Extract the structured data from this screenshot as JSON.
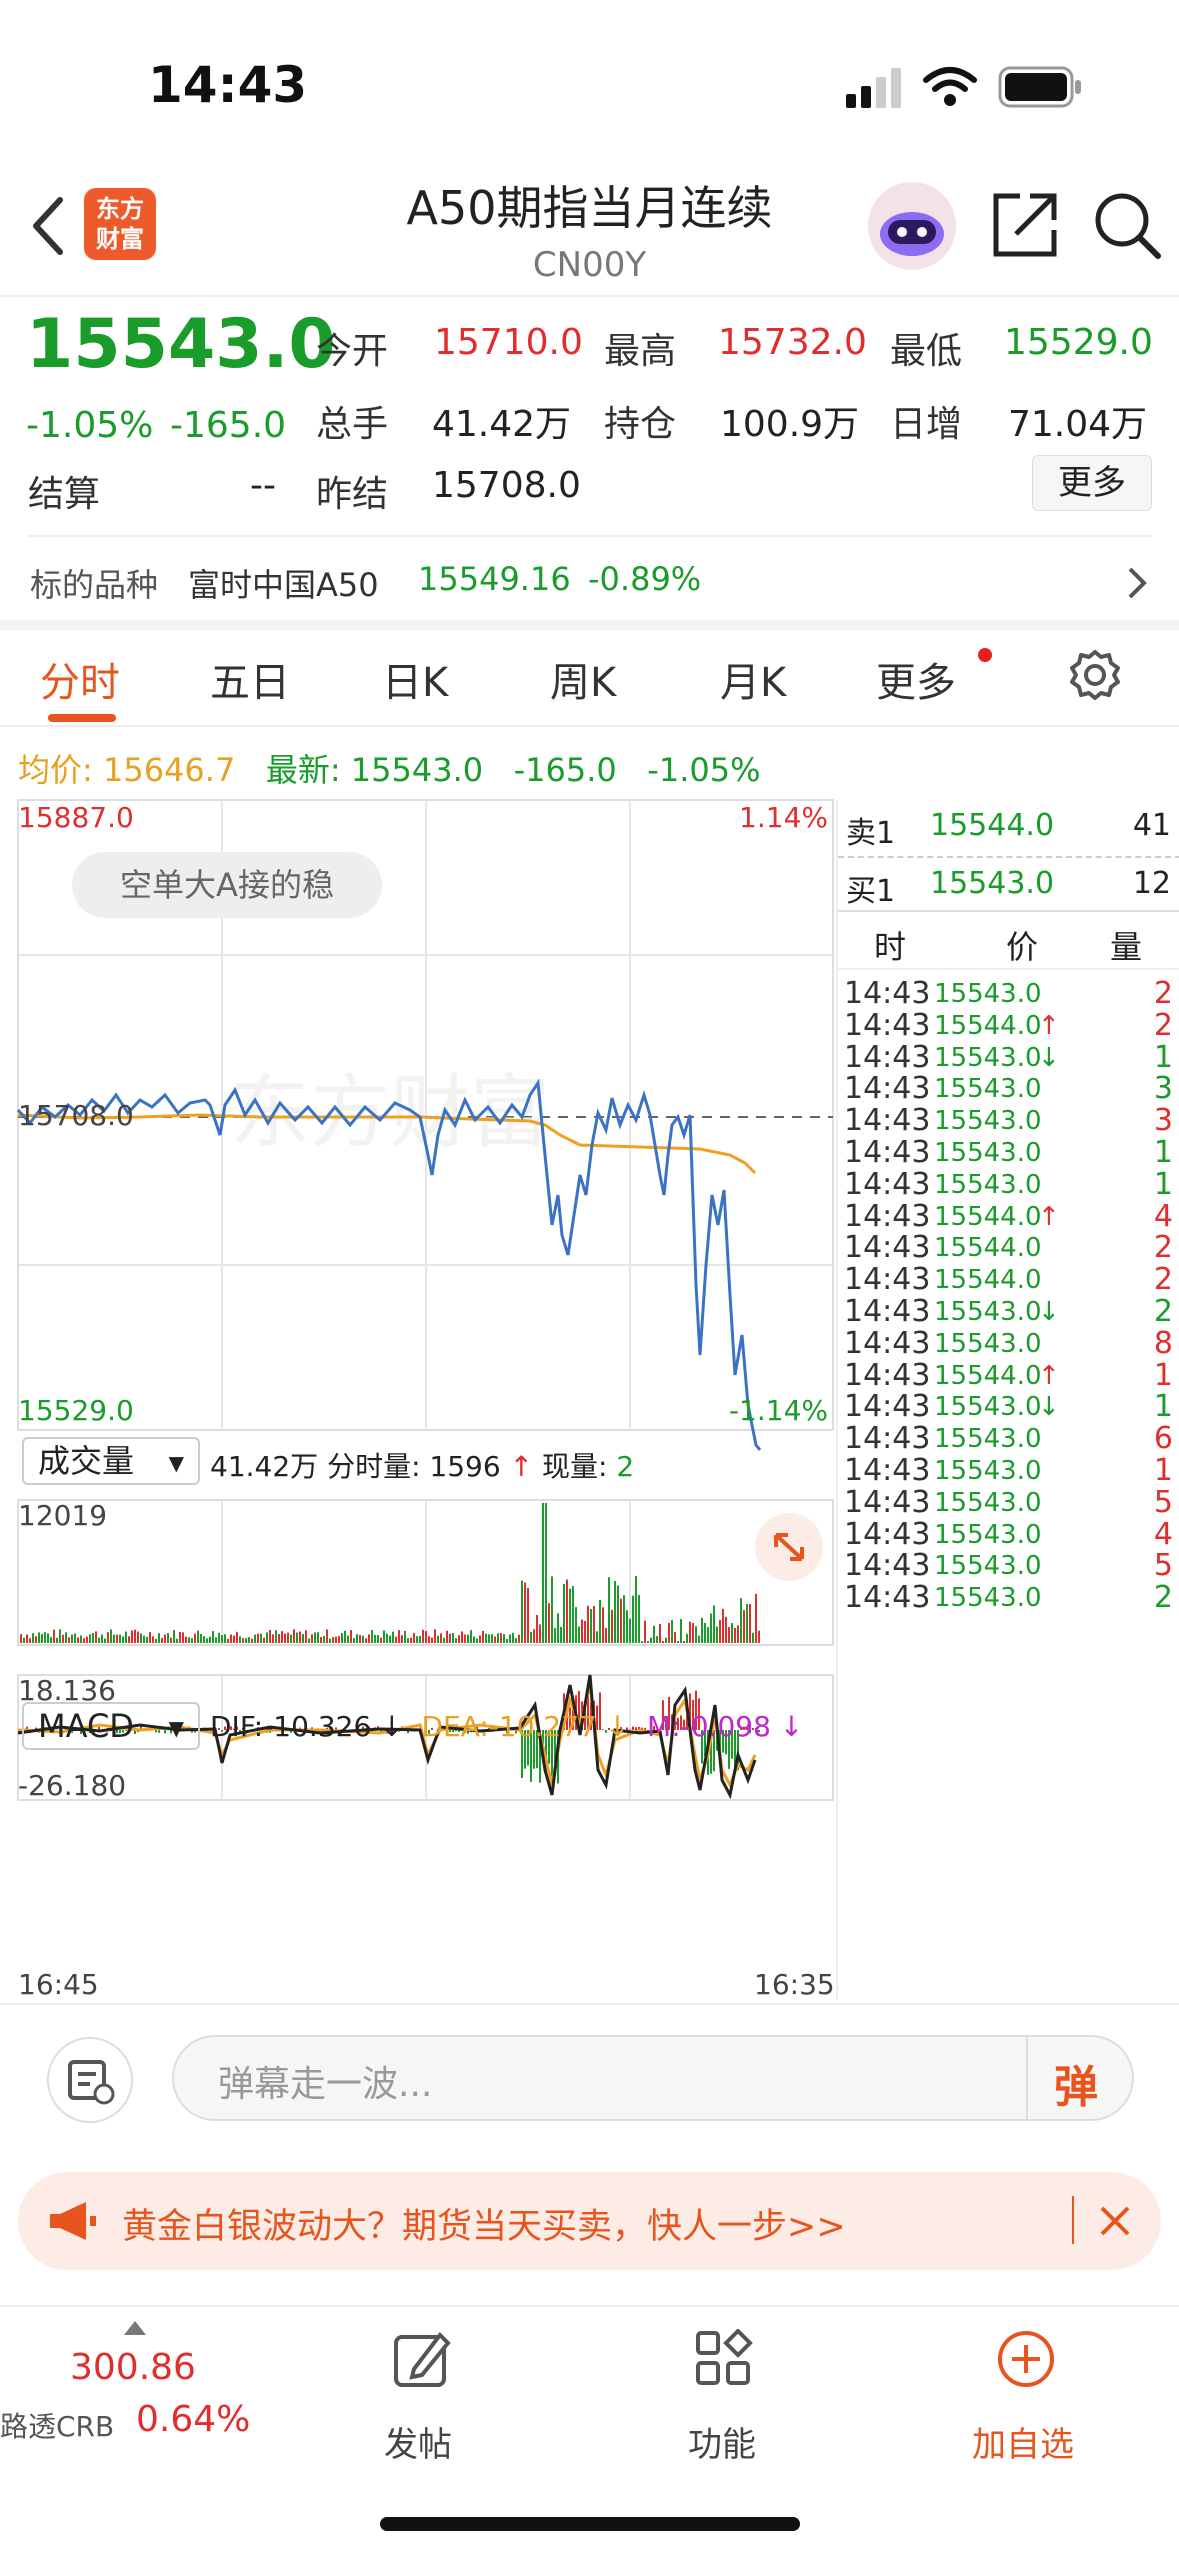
{
  "status": {
    "time": "14:43"
  },
  "nav": {
    "title": "A50期指当月连续",
    "code": "CN00Y",
    "logo_line1": "东方",
    "logo_line2": "财富"
  },
  "quote": {
    "price": "15543.0",
    "change_pct": "-1.05%",
    "change": "-165.0",
    "open_label": "今开",
    "open": "15710.0",
    "high_label": "最高",
    "high": "15732.0",
    "low_label": "最低",
    "low": "15529.0",
    "volume_label": "总手",
    "volume": "41.42万",
    "oi_label": "持仓",
    "oi": "100.9万",
    "daily_inc_label": "日增",
    "daily_inc": "71.04万",
    "settle_label": "结算",
    "settle": "--",
    "prev_settle_label": "昨结",
    "prev_settle": "15708.0",
    "more_label": "更多"
  },
  "underlying": {
    "label": "标的品种",
    "name": "富时中国A50",
    "price": "15549.16",
    "pct": "-0.89%"
  },
  "tabs": [
    "分时",
    "五日",
    "日K",
    "周K",
    "月K",
    "更多"
  ],
  "avg": {
    "avg_label": "均价:",
    "avg_value": "15646.7",
    "latest_label": "最新:",
    "latest_value": "15543.0",
    "change": "-165.0",
    "pct": "-1.05%"
  },
  "main_chart": {
    "y_top": "15887.0",
    "y_mid": "15708.0",
    "y_bot": "15529.0",
    "pct_top": "1.14%",
    "pct_bot": "-1.14%",
    "bubble": "空单大A接的稳",
    "watermark": "东方财富"
  },
  "vol_chart": {
    "selector": "成交量",
    "total": "41.42万",
    "tick_label": "分时量:",
    "tick_value": "1596",
    "tick_arrow": "↑",
    "now_label": "现量:",
    "now_value": "2",
    "y_max": "12019"
  },
  "macd": {
    "selector": "MACD",
    "dif": "DIF:-10.326 ↓",
    "dea": "DEA:-10.277 ↓",
    "m": "M:-0.098 ↓",
    "y_top": "18.136",
    "y_bot": "-26.180"
  },
  "x_axis": {
    "start": "16:45",
    "end": "16:35"
  },
  "order_book": {
    "sell": {
      "label": "卖1",
      "price": "15544.0",
      "qty": "41"
    },
    "buy": {
      "label": "买1",
      "price": "15543.0",
      "qty": "12"
    },
    "header": {
      "time": "时",
      "price": "价",
      "qty": "量"
    }
  },
  "trades": [
    {
      "t": "14:43",
      "p": "15543.0",
      "a": "",
      "q": "2",
      "qc": "#e02d2d"
    },
    {
      "t": "14:43",
      "p": "15544.0",
      "a": "↑",
      "q": "2",
      "qc": "#e02d2d"
    },
    {
      "t": "14:43",
      "p": "15543.0",
      "a": "↓",
      "q": "1",
      "qc": "#1a9c2a"
    },
    {
      "t": "14:43",
      "p": "15543.0",
      "a": "",
      "q": "3",
      "qc": "#1a9c2a"
    },
    {
      "t": "14:43",
      "p": "15543.0",
      "a": "",
      "q": "3",
      "qc": "#e02d2d"
    },
    {
      "t": "14:43",
      "p": "15543.0",
      "a": "",
      "q": "1",
      "qc": "#1a9c2a"
    },
    {
      "t": "14:43",
      "p": "15543.0",
      "a": "",
      "q": "1",
      "qc": "#1a9c2a"
    },
    {
      "t": "14:43",
      "p": "15544.0",
      "a": "↑",
      "q": "4",
      "qc": "#e02d2d"
    },
    {
      "t": "14:43",
      "p": "15544.0",
      "a": "",
      "q": "2",
      "qc": "#e02d2d"
    },
    {
      "t": "14:43",
      "p": "15544.0",
      "a": "",
      "q": "2",
      "qc": "#e02d2d"
    },
    {
      "t": "14:43",
      "p": "15543.0",
      "a": "↓",
      "q": "2",
      "qc": "#1a9c2a"
    },
    {
      "t": "14:43",
      "p": "15543.0",
      "a": "",
      "q": "8",
      "qc": "#e02d2d"
    },
    {
      "t": "14:43",
      "p": "15544.0",
      "a": "↑",
      "q": "1",
      "qc": "#e02d2d"
    },
    {
      "t": "14:43",
      "p": "15543.0",
      "a": "↓",
      "q": "1",
      "qc": "#1a9c2a"
    },
    {
      "t": "14:43",
      "p": "15543.0",
      "a": "",
      "q": "6",
      "qc": "#e02d2d"
    },
    {
      "t": "14:43",
      "p": "15543.0",
      "a": "",
      "q": "1",
      "qc": "#e02d2d"
    },
    {
      "t": "14:43",
      "p": "15543.0",
      "a": "",
      "q": "5",
      "qc": "#e02d2d"
    },
    {
      "t": "14:43",
      "p": "15543.0",
      "a": "",
      "q": "4",
      "qc": "#e02d2d"
    },
    {
      "t": "14:43",
      "p": "15543.0",
      "a": "",
      "q": "5",
      "qc": "#e02d2d"
    },
    {
      "t": "14:43",
      "p": "15543.0",
      "a": "",
      "q": "2",
      "qc": "#1a9c2a"
    }
  ],
  "comment": {
    "placeholder": "弹幕走一波...",
    "send": "弹"
  },
  "banner": {
    "text": "黄金白银波动大？期货当天买卖，快人一步>>"
  },
  "tabbar": {
    "ticker_value": "300.86",
    "ticker_name": "路透CRB",
    "ticker_pct": "0.64%",
    "post": "发帖",
    "features": "功能",
    "watch": "加自选"
  }
}
